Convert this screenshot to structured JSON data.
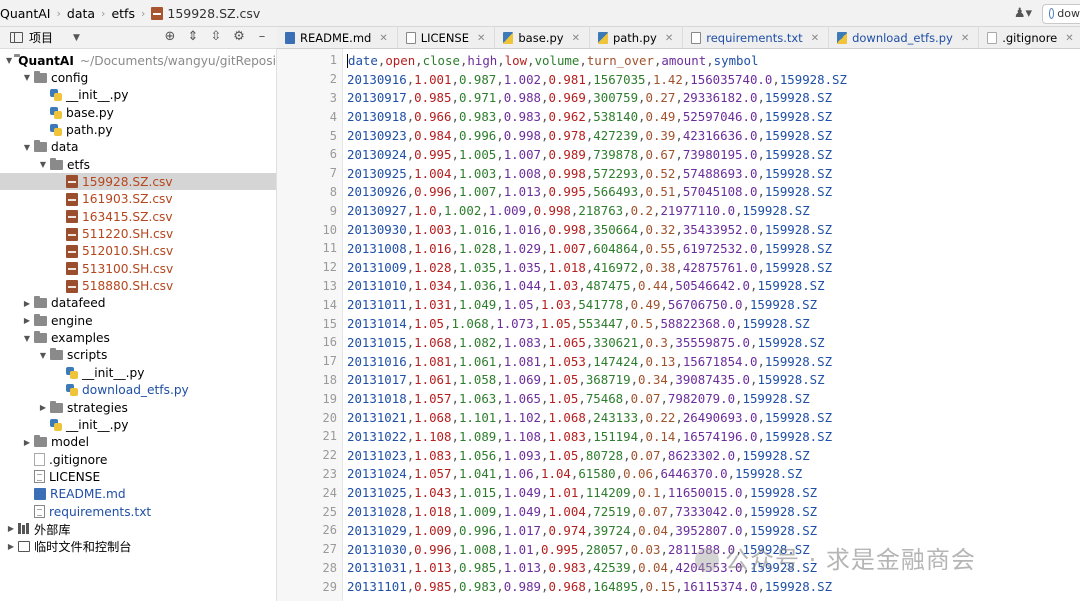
{
  "breadcrumb": [
    "QuantAI",
    "data",
    "etfs",
    "159928.SZ.csv"
  ],
  "run_config": {
    "label": "dow"
  },
  "project_panel": {
    "title": "项目"
  },
  "tree": [
    {
      "indent": 0,
      "arrow": "down",
      "icon": "folder",
      "label": "QuantAI",
      "path": "~/Documents/wangyu/gitRepositories",
      "bold": true
    },
    {
      "indent": 1,
      "arrow": "down",
      "icon": "folder",
      "label": "config"
    },
    {
      "indent": 2,
      "arrow": "",
      "icon": "py",
      "label": "__init__.py"
    },
    {
      "indent": 2,
      "arrow": "",
      "icon": "py",
      "label": "base.py"
    },
    {
      "indent": 2,
      "arrow": "",
      "icon": "py",
      "label": "path.py"
    },
    {
      "indent": 1,
      "arrow": "down",
      "icon": "folder",
      "label": "data"
    },
    {
      "indent": 2,
      "arrow": "down",
      "icon": "folder",
      "label": "etfs"
    },
    {
      "indent": 3,
      "arrow": "",
      "icon": "csv",
      "label": "159928.SZ.csv",
      "color": "red",
      "selected": true
    },
    {
      "indent": 3,
      "arrow": "",
      "icon": "csv",
      "label": "161903.SZ.csv",
      "color": "red"
    },
    {
      "indent": 3,
      "arrow": "",
      "icon": "csv",
      "label": "163415.SZ.csv",
      "color": "red"
    },
    {
      "indent": 3,
      "arrow": "",
      "icon": "csv",
      "label": "511220.SH.csv",
      "color": "red"
    },
    {
      "indent": 3,
      "arrow": "",
      "icon": "csv",
      "label": "512010.SH.csv",
      "color": "red"
    },
    {
      "indent": 3,
      "arrow": "",
      "icon": "csv",
      "label": "513100.SH.csv",
      "color": "red"
    },
    {
      "indent": 3,
      "arrow": "",
      "icon": "csv",
      "label": "518880.SH.csv",
      "color": "red"
    },
    {
      "indent": 1,
      "arrow": "right",
      "icon": "folder",
      "label": "datafeed"
    },
    {
      "indent": 1,
      "arrow": "right",
      "icon": "folder",
      "label": "engine"
    },
    {
      "indent": 1,
      "arrow": "down",
      "icon": "folder",
      "label": "examples"
    },
    {
      "indent": 2,
      "arrow": "down",
      "icon": "folder",
      "label": "scripts"
    },
    {
      "indent": 3,
      "arrow": "",
      "icon": "py",
      "label": "__init__.py"
    },
    {
      "indent": 3,
      "arrow": "",
      "icon": "py",
      "label": "download_etfs.py",
      "color": "blue"
    },
    {
      "indent": 2,
      "arrow": "right",
      "icon": "folder",
      "label": "strategies"
    },
    {
      "indent": 2,
      "arrow": "",
      "icon": "py",
      "label": "__init__.py"
    },
    {
      "indent": 1,
      "arrow": "right",
      "icon": "folder",
      "label": "model"
    },
    {
      "indent": 1,
      "arrow": "",
      "icon": "git",
      "label": ".gitignore"
    },
    {
      "indent": 1,
      "arrow": "",
      "icon": "txt",
      "label": "LICENSE"
    },
    {
      "indent": 1,
      "arrow": "",
      "icon": "md",
      "label": "README.md",
      "color": "blue"
    },
    {
      "indent": 1,
      "arrow": "",
      "icon": "txt",
      "label": "requirements.txt",
      "color": "blue"
    },
    {
      "indent": 0,
      "arrow": "right",
      "icon": "lib",
      "label": "外部库"
    },
    {
      "indent": 0,
      "arrow": "right",
      "icon": "console",
      "label": "临时文件和控制台"
    }
  ],
  "tabs": [
    {
      "label": "README.md",
      "icon": "md"
    },
    {
      "label": "LICENSE",
      "icon": "txt"
    },
    {
      "label": "base.py",
      "icon": "py"
    },
    {
      "label": "path.py",
      "icon": "py"
    },
    {
      "label": "requirements.txt",
      "icon": "txt",
      "blue": true
    },
    {
      "label": "download_etfs.py",
      "icon": "py",
      "blue": true
    },
    {
      "label": ".gitignore",
      "icon": "git"
    },
    {
      "label": "159928.SZ.csv",
      "icon": "csv",
      "active": true
    }
  ],
  "csv": {
    "header": [
      "date",
      "open",
      "close",
      "high",
      "low",
      "volume",
      "turn_over",
      "amount",
      "symbol"
    ],
    "rows": [
      [
        "20130916",
        "1.001",
        "0.987",
        "1.002",
        "0.981",
        "1567035",
        "1.42",
        "156035740.0",
        "159928.SZ"
      ],
      [
        "20130917",
        "0.985",
        "0.971",
        "0.988",
        "0.969",
        "300759",
        "0.27",
        "29336182.0",
        "159928.SZ"
      ],
      [
        "20130918",
        "0.966",
        "0.983",
        "0.983",
        "0.962",
        "538140",
        "0.49",
        "52597046.0",
        "159928.SZ"
      ],
      [
        "20130923",
        "0.984",
        "0.996",
        "0.998",
        "0.978",
        "427239",
        "0.39",
        "42316636.0",
        "159928.SZ"
      ],
      [
        "20130924",
        "0.995",
        "1.005",
        "1.007",
        "0.989",
        "739878",
        "0.67",
        "73980195.0",
        "159928.SZ"
      ],
      [
        "20130925",
        "1.004",
        "1.003",
        "1.008",
        "0.998",
        "572293",
        "0.52",
        "57488693.0",
        "159928.SZ"
      ],
      [
        "20130926",
        "0.996",
        "1.007",
        "1.013",
        "0.995",
        "566493",
        "0.51",
        "57045108.0",
        "159928.SZ"
      ],
      [
        "20130927",
        "1.0",
        "1.002",
        "1.009",
        "0.998",
        "218763",
        "0.2",
        "21977110.0",
        "159928.SZ"
      ],
      [
        "20130930",
        "1.003",
        "1.016",
        "1.016",
        "0.998",
        "350664",
        "0.32",
        "35433952.0",
        "159928.SZ"
      ],
      [
        "20131008",
        "1.016",
        "1.028",
        "1.029",
        "1.007",
        "604864",
        "0.55",
        "61972532.0",
        "159928.SZ"
      ],
      [
        "20131009",
        "1.028",
        "1.035",
        "1.035",
        "1.018",
        "416972",
        "0.38",
        "42875761.0",
        "159928.SZ"
      ],
      [
        "20131010",
        "1.034",
        "1.036",
        "1.044",
        "1.03",
        "487475",
        "0.44",
        "50546642.0",
        "159928.SZ"
      ],
      [
        "20131011",
        "1.031",
        "1.049",
        "1.05",
        "1.03",
        "541778",
        "0.49",
        "56706750.0",
        "159928.SZ"
      ],
      [
        "20131014",
        "1.05",
        "1.068",
        "1.073",
        "1.05",
        "553447",
        "0.5",
        "58822368.0",
        "159928.SZ"
      ],
      [
        "20131015",
        "1.068",
        "1.082",
        "1.083",
        "1.065",
        "330621",
        "0.3",
        "35559875.0",
        "159928.SZ"
      ],
      [
        "20131016",
        "1.081",
        "1.061",
        "1.081",
        "1.053",
        "147424",
        "0.13",
        "15671854.0",
        "159928.SZ"
      ],
      [
        "20131017",
        "1.061",
        "1.058",
        "1.069",
        "1.05",
        "368719",
        "0.34",
        "39087435.0",
        "159928.SZ"
      ],
      [
        "20131018",
        "1.057",
        "1.063",
        "1.065",
        "1.05",
        "75468",
        "0.07",
        "7982079.0",
        "159928.SZ"
      ],
      [
        "20131021",
        "1.068",
        "1.101",
        "1.102",
        "1.068",
        "243133",
        "0.22",
        "26490693.0",
        "159928.SZ"
      ],
      [
        "20131022",
        "1.108",
        "1.089",
        "1.108",
        "1.083",
        "151194",
        "0.14",
        "16574196.0",
        "159928.SZ"
      ],
      [
        "20131023",
        "1.083",
        "1.056",
        "1.093",
        "1.05",
        "80728",
        "0.07",
        "8623302.0",
        "159928.SZ"
      ],
      [
        "20131024",
        "1.057",
        "1.041",
        "1.06",
        "1.04",
        "61580",
        "0.06",
        "6446370.0",
        "159928.SZ"
      ],
      [
        "20131025",
        "1.043",
        "1.015",
        "1.049",
        "1.01",
        "114209",
        "0.1",
        "11650015.0",
        "159928.SZ"
      ],
      [
        "20131028",
        "1.018",
        "1.009",
        "1.049",
        "1.004",
        "72519",
        "0.07",
        "7333042.0",
        "159928.SZ"
      ],
      [
        "20131029",
        "1.009",
        "0.996",
        "1.017",
        "0.974",
        "39724",
        "0.04",
        "3952807.0",
        "159928.SZ"
      ],
      [
        "20131030",
        "0.996",
        "1.008",
        "1.01",
        "0.995",
        "28057",
        "0.03",
        "2811588.0",
        "159928.SZ"
      ],
      [
        "20131031",
        "1.013",
        "0.985",
        "1.013",
        "0.983",
        "42539",
        "0.04",
        "4204553.0",
        "159928.SZ"
      ],
      [
        "20131101",
        "0.985",
        "0.983",
        "0.989",
        "0.968",
        "164895",
        "0.15",
        "16115374.0",
        "159928.SZ"
      ]
    ]
  },
  "watermark": "公众号 · 求是金融商会"
}
